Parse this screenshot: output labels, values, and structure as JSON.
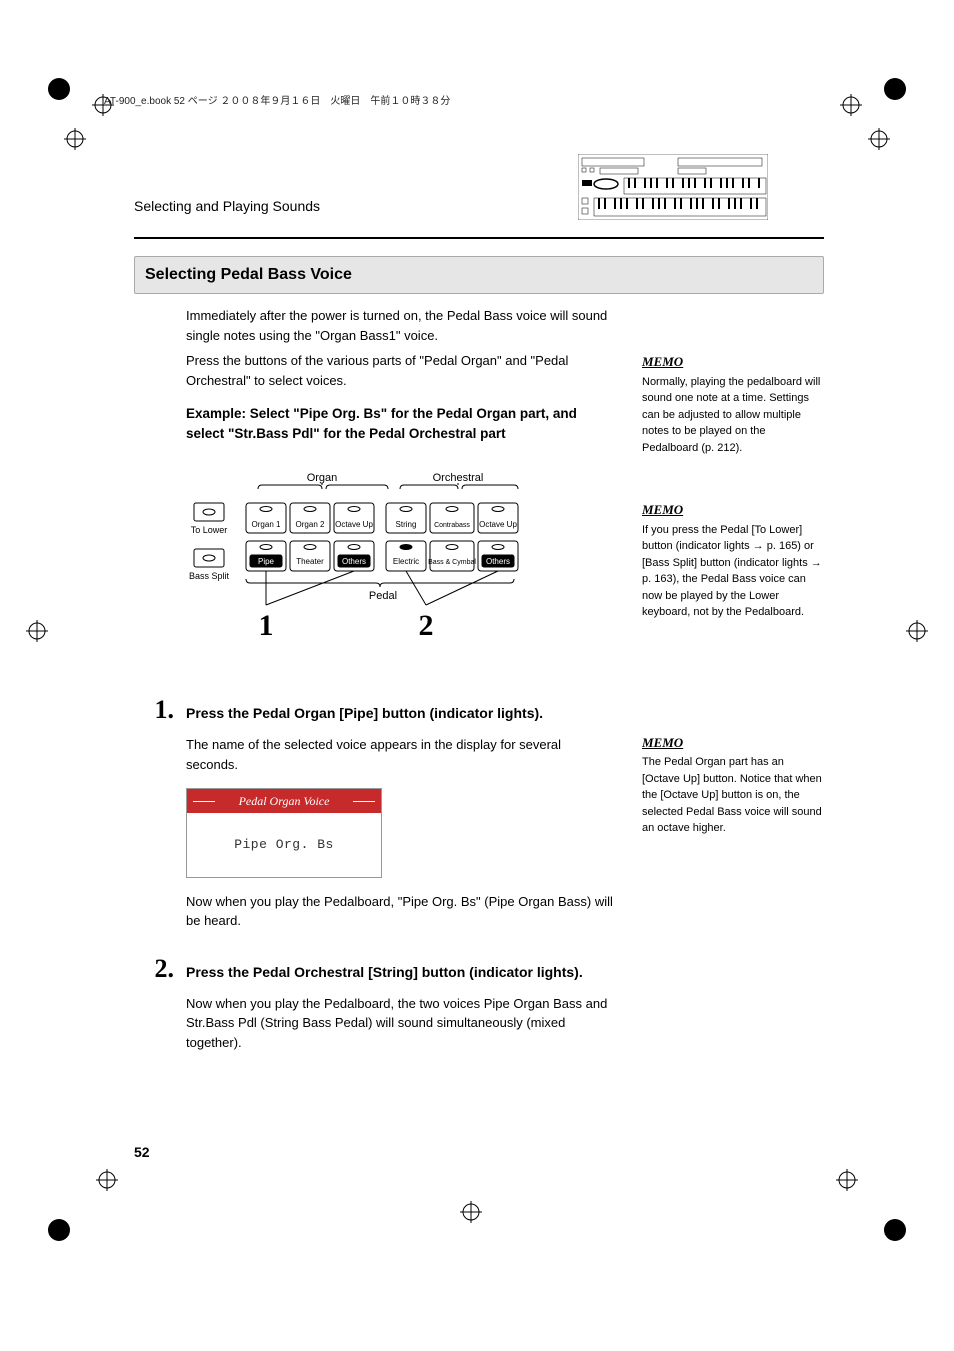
{
  "header": {
    "book_tag": "AT-900_e.book  52 ページ  ２００８年９月１６日　火曜日　午前１０時３８分"
  },
  "chapter": {
    "running_head": "Selecting and Playing Sounds"
  },
  "section": {
    "title": "Selecting Pedal Bass Voice",
    "para1": "Immediately after the power is turned on, the Pedal Bass voice will sound single notes using the \"Organ Bass1\" voice.",
    "para2": "Press the buttons of the various parts of \"Pedal Organ\" and \"Pedal Orchestral\" to select voices.",
    "example_heading": "Example: Select \"Pipe Org. Bs\" for the Pedal Organ part, and select \"Str.Bass Pdl\" for the Pedal Orchestral part"
  },
  "diagram": {
    "group1_label": "Organ",
    "group2_label": "Orchestral",
    "btn_to_lower": "To Lower",
    "btn_bass_split": "Bass Split",
    "row1": [
      "Organ 1",
      "Organ 2",
      "Octave Up"
    ],
    "row1b": [
      "String",
      "Contrabass",
      "Octave Up"
    ],
    "row2": [
      "Pipe",
      "Theater",
      "Others"
    ],
    "row2b": [
      "Electric",
      "Bass & Cymbal",
      "Others"
    ],
    "footer_label": "Pedal",
    "callout1": "1",
    "callout2": "2"
  },
  "memo": {
    "label": "MEMO",
    "m1": "Normally, playing the pedalboard will sound one note at a time. Settings can be adjusted to allow multiple notes to be played on the Pedalboard (p. 212).",
    "m2": "If you press the Pedal [To Lower] button (indicator lights → p. 165) or [Bass Split] button (indicator lights → p. 163), the Pedal Bass voice can now be played by the Lower keyboard, not by the Pedalboard.",
    "m3": "The Pedal Organ part has an [Octave Up] button. Notice that when the [Octave Up] button is on, the selected Pedal Bass voice will sound an octave higher."
  },
  "steps": {
    "s1": {
      "num": "1.",
      "title": "Press the Pedal Organ [Pipe] button (indicator lights).",
      "body1": "The name of the selected voice appears in the display for several seconds.",
      "display_title": "Pedal Organ Voice",
      "display_value": "Pipe Org. Bs",
      "body2": "Now when you play the Pedalboard, \"Pipe Org. Bs\" (Pipe Organ Bass) will be heard."
    },
    "s2": {
      "num": "2.",
      "title": "Press the Pedal Orchestral [String] button (indicator lights).",
      "body": "Now when you play the Pedalboard, the two voices Pipe Organ Bass and Str.Bass Pdl (String Bass Pedal) will sound simultaneously (mixed together)."
    }
  },
  "page_number": "52"
}
